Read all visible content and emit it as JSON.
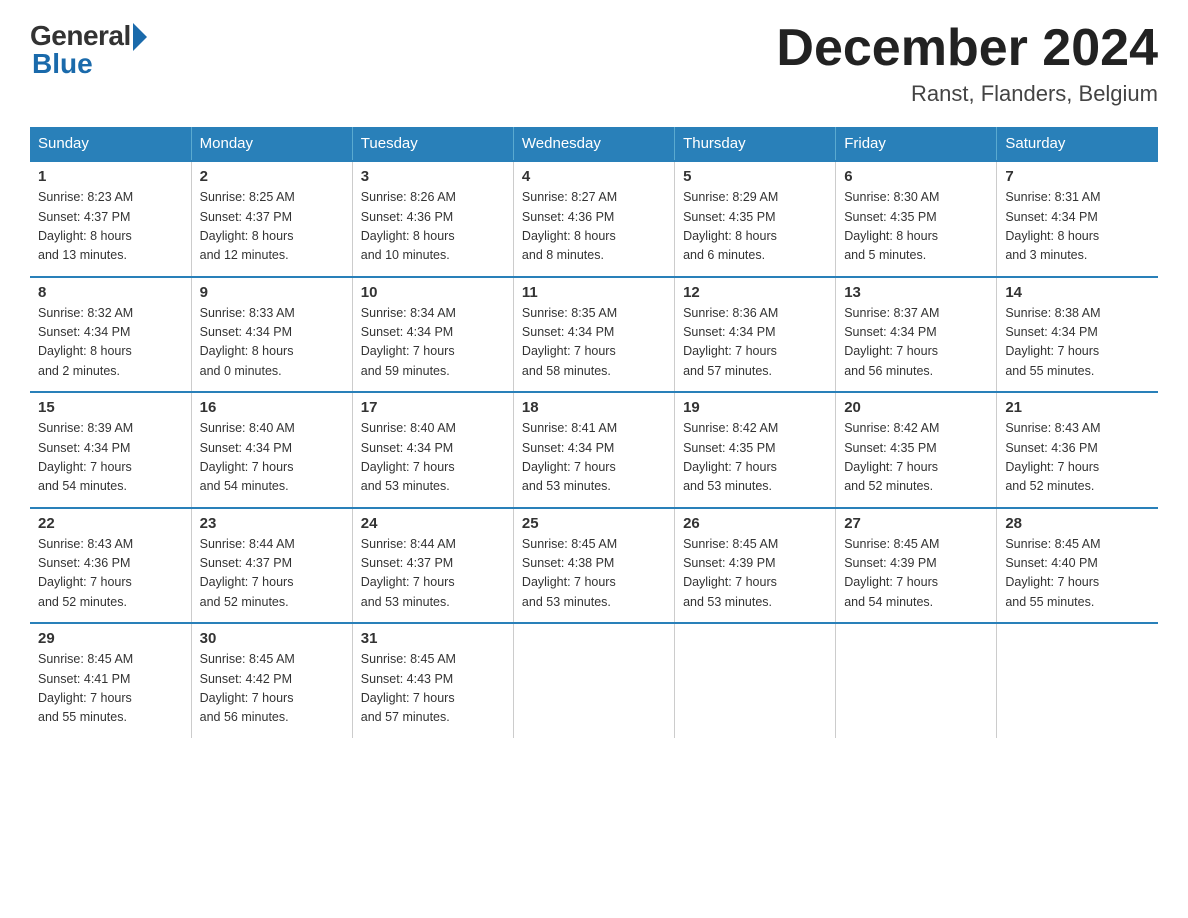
{
  "header": {
    "logo_general": "General",
    "logo_blue": "Blue",
    "month_title": "December 2024",
    "location": "Ranst, Flanders, Belgium"
  },
  "days_of_week": [
    "Sunday",
    "Monday",
    "Tuesday",
    "Wednesday",
    "Thursday",
    "Friday",
    "Saturday"
  ],
  "weeks": [
    [
      {
        "day": "1",
        "info": "Sunrise: 8:23 AM\nSunset: 4:37 PM\nDaylight: 8 hours\nand 13 minutes."
      },
      {
        "day": "2",
        "info": "Sunrise: 8:25 AM\nSunset: 4:37 PM\nDaylight: 8 hours\nand 12 minutes."
      },
      {
        "day": "3",
        "info": "Sunrise: 8:26 AM\nSunset: 4:36 PM\nDaylight: 8 hours\nand 10 minutes."
      },
      {
        "day": "4",
        "info": "Sunrise: 8:27 AM\nSunset: 4:36 PM\nDaylight: 8 hours\nand 8 minutes."
      },
      {
        "day": "5",
        "info": "Sunrise: 8:29 AM\nSunset: 4:35 PM\nDaylight: 8 hours\nand 6 minutes."
      },
      {
        "day": "6",
        "info": "Sunrise: 8:30 AM\nSunset: 4:35 PM\nDaylight: 8 hours\nand 5 minutes."
      },
      {
        "day": "7",
        "info": "Sunrise: 8:31 AM\nSunset: 4:34 PM\nDaylight: 8 hours\nand 3 minutes."
      }
    ],
    [
      {
        "day": "8",
        "info": "Sunrise: 8:32 AM\nSunset: 4:34 PM\nDaylight: 8 hours\nand 2 minutes."
      },
      {
        "day": "9",
        "info": "Sunrise: 8:33 AM\nSunset: 4:34 PM\nDaylight: 8 hours\nand 0 minutes."
      },
      {
        "day": "10",
        "info": "Sunrise: 8:34 AM\nSunset: 4:34 PM\nDaylight: 7 hours\nand 59 minutes."
      },
      {
        "day": "11",
        "info": "Sunrise: 8:35 AM\nSunset: 4:34 PM\nDaylight: 7 hours\nand 58 minutes."
      },
      {
        "day": "12",
        "info": "Sunrise: 8:36 AM\nSunset: 4:34 PM\nDaylight: 7 hours\nand 57 minutes."
      },
      {
        "day": "13",
        "info": "Sunrise: 8:37 AM\nSunset: 4:34 PM\nDaylight: 7 hours\nand 56 minutes."
      },
      {
        "day": "14",
        "info": "Sunrise: 8:38 AM\nSunset: 4:34 PM\nDaylight: 7 hours\nand 55 minutes."
      }
    ],
    [
      {
        "day": "15",
        "info": "Sunrise: 8:39 AM\nSunset: 4:34 PM\nDaylight: 7 hours\nand 54 minutes."
      },
      {
        "day": "16",
        "info": "Sunrise: 8:40 AM\nSunset: 4:34 PM\nDaylight: 7 hours\nand 54 minutes."
      },
      {
        "day": "17",
        "info": "Sunrise: 8:40 AM\nSunset: 4:34 PM\nDaylight: 7 hours\nand 53 minutes."
      },
      {
        "day": "18",
        "info": "Sunrise: 8:41 AM\nSunset: 4:34 PM\nDaylight: 7 hours\nand 53 minutes."
      },
      {
        "day": "19",
        "info": "Sunrise: 8:42 AM\nSunset: 4:35 PM\nDaylight: 7 hours\nand 53 minutes."
      },
      {
        "day": "20",
        "info": "Sunrise: 8:42 AM\nSunset: 4:35 PM\nDaylight: 7 hours\nand 52 minutes."
      },
      {
        "day": "21",
        "info": "Sunrise: 8:43 AM\nSunset: 4:36 PM\nDaylight: 7 hours\nand 52 minutes."
      }
    ],
    [
      {
        "day": "22",
        "info": "Sunrise: 8:43 AM\nSunset: 4:36 PM\nDaylight: 7 hours\nand 52 minutes."
      },
      {
        "day": "23",
        "info": "Sunrise: 8:44 AM\nSunset: 4:37 PM\nDaylight: 7 hours\nand 52 minutes."
      },
      {
        "day": "24",
        "info": "Sunrise: 8:44 AM\nSunset: 4:37 PM\nDaylight: 7 hours\nand 53 minutes."
      },
      {
        "day": "25",
        "info": "Sunrise: 8:45 AM\nSunset: 4:38 PM\nDaylight: 7 hours\nand 53 minutes."
      },
      {
        "day": "26",
        "info": "Sunrise: 8:45 AM\nSunset: 4:39 PM\nDaylight: 7 hours\nand 53 minutes."
      },
      {
        "day": "27",
        "info": "Sunrise: 8:45 AM\nSunset: 4:39 PM\nDaylight: 7 hours\nand 54 minutes."
      },
      {
        "day": "28",
        "info": "Sunrise: 8:45 AM\nSunset: 4:40 PM\nDaylight: 7 hours\nand 55 minutes."
      }
    ],
    [
      {
        "day": "29",
        "info": "Sunrise: 8:45 AM\nSunset: 4:41 PM\nDaylight: 7 hours\nand 55 minutes."
      },
      {
        "day": "30",
        "info": "Sunrise: 8:45 AM\nSunset: 4:42 PM\nDaylight: 7 hours\nand 56 minutes."
      },
      {
        "day": "31",
        "info": "Sunrise: 8:45 AM\nSunset: 4:43 PM\nDaylight: 7 hours\nand 57 minutes."
      },
      {
        "day": "",
        "info": ""
      },
      {
        "day": "",
        "info": ""
      },
      {
        "day": "",
        "info": ""
      },
      {
        "day": "",
        "info": ""
      }
    ]
  ]
}
